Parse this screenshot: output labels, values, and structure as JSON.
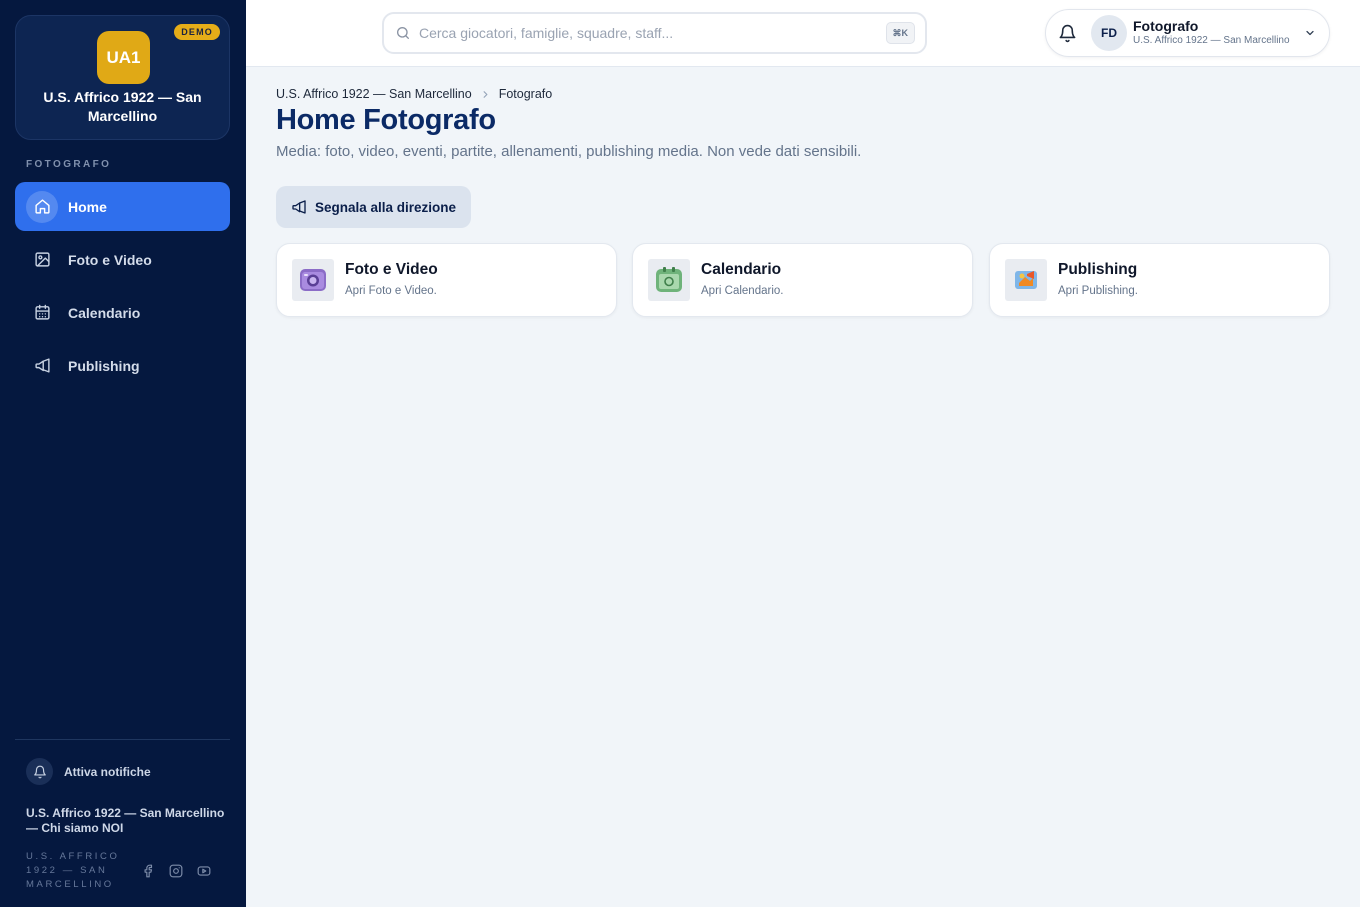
{
  "sidebar": {
    "club_logo_text": "UA1",
    "demo_badge": "DEMO",
    "club_name": "U.S. Affrico 1922 — San Marcellino",
    "section_label": "FOTOGRAFO",
    "items": [
      {
        "label": "Home",
        "icon": "home-icon",
        "active": true
      },
      {
        "label": "Foto e Video",
        "icon": "image-icon",
        "active": false
      },
      {
        "label": "Calendario",
        "icon": "calendar-icon",
        "active": false
      },
      {
        "label": "Publishing",
        "icon": "megaphone-icon",
        "active": false
      }
    ],
    "notifications_label": "Attiva notifiche",
    "footer_name": "U.S. Affrico 1922 — San Marcellino — Chi siamo NOI",
    "footer_caps": "U.S. AFFRICO 1922 — SAN MARCELLINO",
    "socials": [
      "facebook-icon",
      "instagram-icon",
      "youtube-icon"
    ]
  },
  "header": {
    "search_placeholder": "Cerca giocatori, famiglie, squadre, staff...",
    "search_shortcut": "⌘K",
    "user": {
      "initials": "FD",
      "role": "Fotografo",
      "club": "U.S. Affrico 1922 — San Marcellino"
    }
  },
  "main": {
    "breadcrumb": [
      "U.S. Affrico 1922 — San Marcellino",
      "Fotografo"
    ],
    "title": "Home Fotografo",
    "subtitle": "Media: foto, video, eventi, partite, allenamenti, publishing media. Non vede dati sensibili.",
    "action_label": "Segnala alla direzione",
    "cards": [
      {
        "title": "Foto e Video",
        "desc": "Apri Foto e Video.",
        "icon": "camera-icon"
      },
      {
        "title": "Calendario",
        "desc": "Apri Calendario.",
        "icon": "calendar-app-icon"
      },
      {
        "title": "Publishing",
        "desc": "Apri Publishing.",
        "icon": "publishing-icon"
      }
    ]
  },
  "colors": {
    "sidebar_bg": "#05183f",
    "accent": "#2f6fed",
    "brand_gold": "#e0a916",
    "title_navy": "#0b2a66"
  }
}
